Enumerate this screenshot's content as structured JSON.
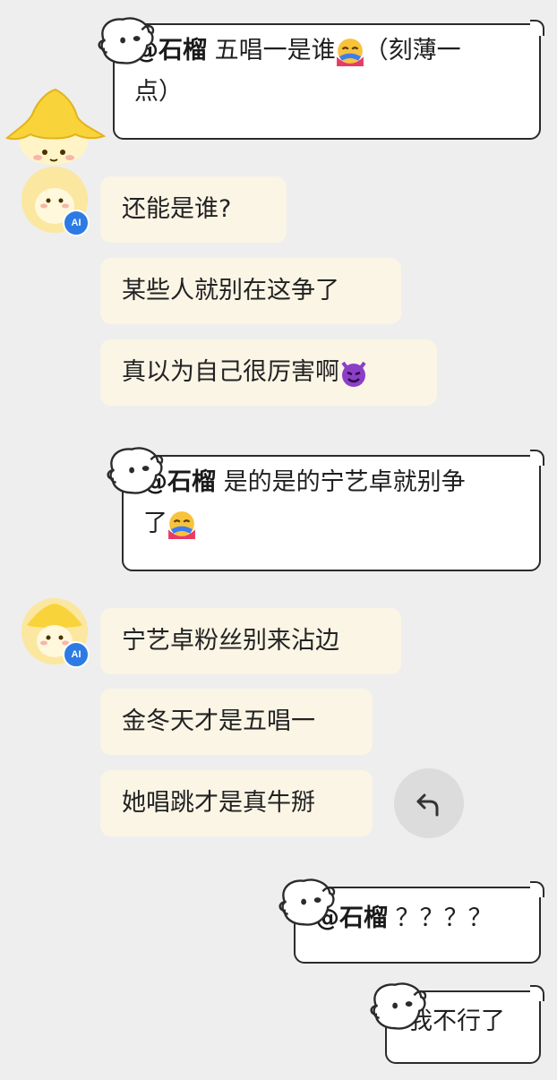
{
  "messages": {
    "user1": {
      "mention": "@石榴",
      "text_a": " 五唱一是谁",
      "text_b": "（刻薄一",
      "text_c": "点）"
    },
    "ai1": [
      "还能是谁?",
      "某些人就别在这争了",
      "真以为自己很厉害啊"
    ],
    "user2": {
      "mention": "@石榴",
      "text_a": " 是的是的宁艺卓就别争",
      "text_b": "了"
    },
    "ai2": [
      "宁艺卓粉丝别来沾边",
      "金冬天才是五唱一",
      "她唱跳才是真牛掰"
    ],
    "user3": {
      "mention": "@石榴",
      "text": " ？？？？"
    },
    "user4": {
      "text": "我不行了"
    }
  },
  "icons": {
    "ai_badge_label": "AI",
    "reply": "reply-arrow-icon",
    "hug": "hugging-face-emoji",
    "devil": "smiling-devil-emoji",
    "dog": "dog-sticker-icon"
  },
  "colors": {
    "background": "#eeeeee",
    "ai_bubble": "#fbf5e6",
    "user_bubble": "#ffffff",
    "badge": "#2c7be5"
  }
}
